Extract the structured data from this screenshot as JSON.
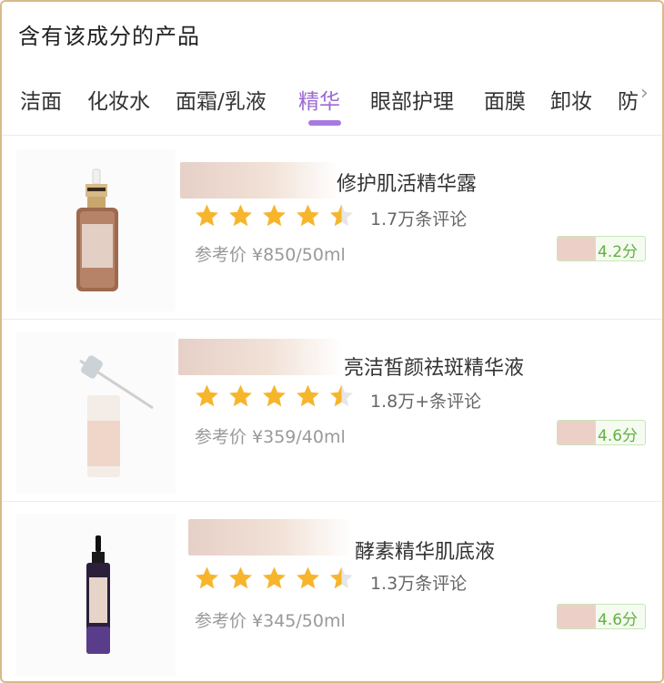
{
  "header": {
    "title": "含有该成分的产品"
  },
  "tabs": {
    "items": [
      "洁面",
      "化妆水",
      "面霜/乳液",
      "精华",
      "眼部护理",
      "面膜",
      "卸妆",
      "防"
    ],
    "active": "精华",
    "more_icon": "chevron-right-icon"
  },
  "products": [
    {
      "name": "修护肌活精华露",
      "rating": 4.5,
      "reviews": "1.7万条评论",
      "price": "参考价 ¥850/50ml",
      "score": "4.2分"
    },
    {
      "name": "亮洁皙颜祛斑精华液",
      "rating": 4.5,
      "reviews": "1.8万+条评论",
      "price": "参考价 ¥359/40ml",
      "score": "4.6分"
    },
    {
      "name": "酵素精华肌底液",
      "rating": 4.5,
      "reviews": "1.3万条评论",
      "price": "参考价 ¥345/50ml",
      "score": "4.6分"
    }
  ],
  "colors": {
    "accent": "#9b69d4",
    "star": "#f7b52c",
    "score_green": "#62b142",
    "border": "#d9b98a"
  }
}
